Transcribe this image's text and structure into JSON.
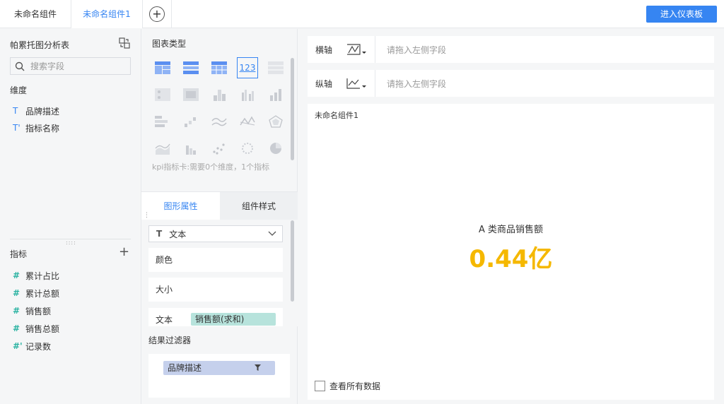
{
  "tabs": [
    {
      "label": "未命名组件",
      "active": false
    },
    {
      "label": "未命名组件1",
      "active": true
    }
  ],
  "header": {
    "enter_dashboard": "进入仪表板"
  },
  "left_panel": {
    "title": "帕累托图分析表",
    "search_placeholder": "搜索字段",
    "dimension_label": "维度",
    "dimensions": [
      {
        "icon": "T",
        "label": "品牌描述"
      },
      {
        "icon": "T'",
        "label": "指标名称"
      }
    ],
    "metric_label": "指标",
    "metrics": [
      {
        "icon": "#",
        "label": "累计占比"
      },
      {
        "icon": "#",
        "label": "累计总额"
      },
      {
        "icon": "#",
        "label": "销售额"
      },
      {
        "icon": "#",
        "label": "销售总额"
      },
      {
        "icon": "#'",
        "label": "记录数"
      }
    ]
  },
  "chart_types": {
    "title": "图表类型",
    "hint": "kpi指标卡:需要0个维度，1个指标",
    "selected_label": "123"
  },
  "properties": {
    "tab_graph": "图形属性",
    "tab_style": "组件样式",
    "mark_type": "文本",
    "color": "颜色",
    "size": "大小",
    "text": "文本",
    "text_field": "销售额(求和)"
  },
  "filter": {
    "title": "结果过滤器",
    "field": "品牌描述"
  },
  "axes": {
    "x_label": "横轴",
    "y_label": "纵轴",
    "placeholder": "请拖入左侧字段"
  },
  "canvas": {
    "name": "未命名组件1",
    "kpi_title": "A 类商品销售额",
    "kpi_value": "0.44亿",
    "kpi_color": "#f5b800",
    "show_all": "查看所有数据"
  }
}
